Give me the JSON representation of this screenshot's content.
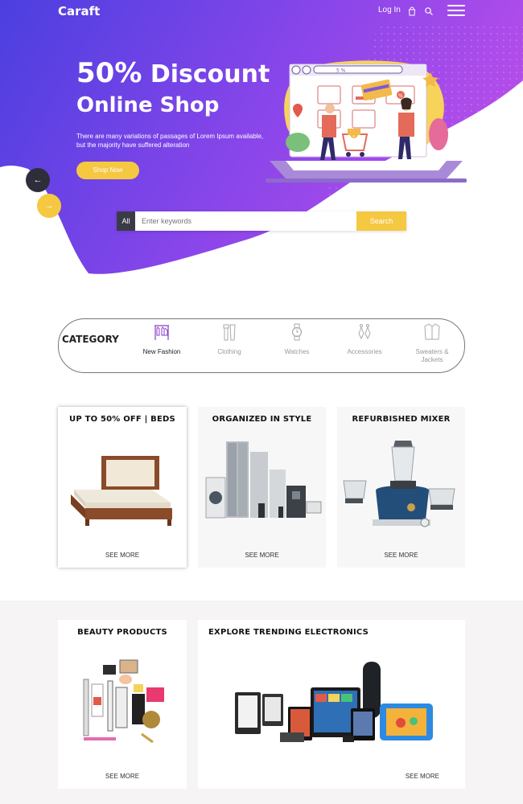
{
  "header": {
    "logo": "Caraft",
    "login_label": "Log In",
    "icons": [
      "bag-icon",
      "search-icon",
      "menu-icon"
    ]
  },
  "hero": {
    "title_pct": "50%",
    "title_rest": " Discount",
    "title_line2": "Online Shop",
    "description": "There are many variations of passages of Lorem Ipsum available, but the majority have suffered alteration",
    "button_label": "Shop Now",
    "prev_arrow": "←",
    "next_arrow": "→",
    "illustration_search_text": "5 %",
    "illustration_badge_percent": "%",
    "illustration_badge_count": "1"
  },
  "search": {
    "category_label": "All",
    "placeholder": "Enter keywords",
    "button_label": "Search"
  },
  "category": {
    "title": "CATEGORY",
    "items": [
      {
        "label": "New Fashion"
      },
      {
        "label": "Clothing"
      },
      {
        "label": "Watches"
      },
      {
        "label": "Accessories"
      },
      {
        "label": "Sweaters & Jackets"
      }
    ]
  },
  "promos": {
    "row1": [
      {
        "title": "UP TO 50% OFF | BEDS",
        "link": "SEE MORE"
      },
      {
        "title": "ORGANIZED IN STYLE",
        "link": "SEE MORE"
      },
      {
        "title": "REFURBISHED MIXER",
        "link": "SEE MORE"
      }
    ],
    "row2": [
      {
        "title": "BEAUTY PRODUCTS",
        "link": "SEE MORE"
      },
      {
        "title": "EXPLORE TRENDING ELECTRONICS",
        "link": "SEE MORE"
      }
    ]
  },
  "colors": {
    "hero_gradient_start": "#4b3fe0",
    "hero_gradient_end": "#b44dea",
    "accent_yellow": "#f5c842",
    "dark": "#2e2e3a"
  }
}
